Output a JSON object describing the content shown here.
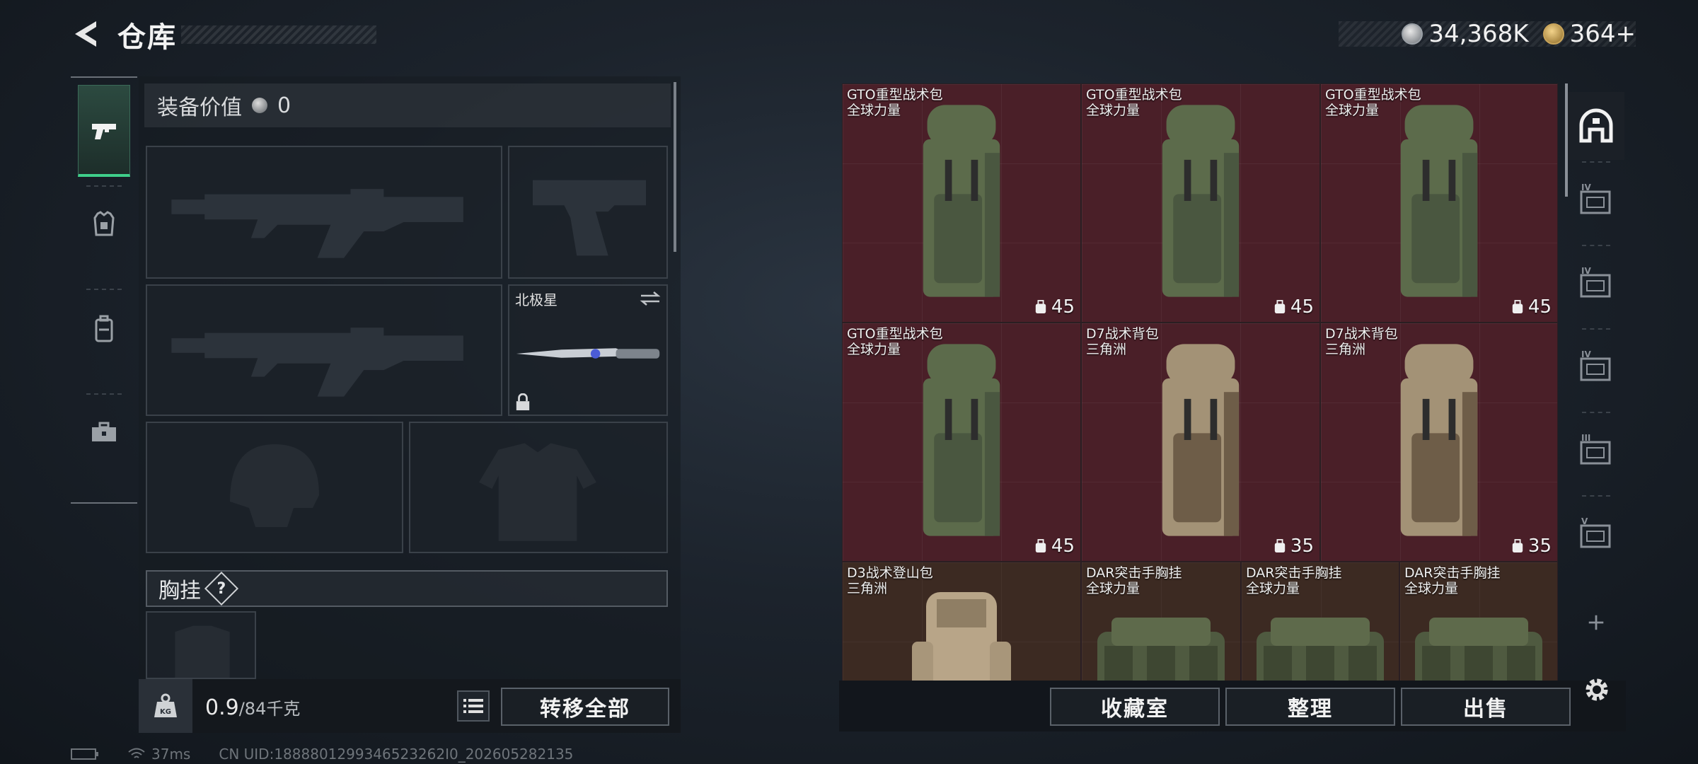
{
  "header": {
    "title": "仓库"
  },
  "currency": {
    "silver": "34,368K",
    "gold": "364+"
  },
  "equipment": {
    "value_label": "装备价值",
    "value": "0",
    "melee_slot_name": "北极星",
    "chest_label": "胸挂",
    "chest_help": "?"
  },
  "capacity": {
    "current": "0.9",
    "max": "/84千克"
  },
  "buttons": {
    "transfer_all": "转移全部",
    "collection": "收藏室",
    "organize": "整理",
    "sell": "出售"
  },
  "items": [
    {
      "name": "GTO重型战术包",
      "source": "全球力量",
      "capacity": "45",
      "color": "red",
      "art": "gto"
    },
    {
      "name": "GTO重型战术包",
      "source": "全球力量",
      "capacity": "45",
      "color": "red",
      "art": "gto"
    },
    {
      "name": "GTO重型战术包",
      "source": "全球力量",
      "capacity": "45",
      "color": "red",
      "art": "gto"
    },
    {
      "name": "GTO重型战术包",
      "source": "全球力量",
      "capacity": "45",
      "color": "red",
      "art": "gto"
    },
    {
      "name": "D7战术背包",
      "source": "三角洲",
      "capacity": "35",
      "color": "red",
      "art": "d7"
    },
    {
      "name": "D7战术背包",
      "source": "三角洲",
      "capacity": "35",
      "color": "red",
      "art": "d7"
    },
    {
      "name": "D3战术登山包",
      "source": "三角洲",
      "capacity": "",
      "color": "brown",
      "art": "d3"
    },
    {
      "name": "DAR突击手胸挂",
      "source": "全球力量",
      "capacity": "",
      "color": "brown",
      "art": "dar"
    },
    {
      "name": "DAR突击手胸挂",
      "source": "全球力量",
      "capacity": "",
      "color": "brown",
      "art": "dar"
    },
    {
      "name": "DAR突击手胸挂",
      "source": "全球力量",
      "capacity": "",
      "color": "brown",
      "art": "dar"
    }
  ],
  "side_tabs": [
    "IV",
    "IV",
    "IV",
    "III",
    "V"
  ],
  "status": {
    "ping": "37ms",
    "uid": "CN UID:1888801299346523262I0_202605282135"
  },
  "colors": {
    "accent": "#3fcf8a",
    "item_red": "#4a1f28",
    "item_brown": "#3c2a22"
  },
  "icons": [
    "back-arrow-icon",
    "silver-coin-icon",
    "gold-coin-icon",
    "pistol-icon",
    "armor-icon",
    "backpack-icon",
    "toolbox-icon",
    "lock-icon",
    "swap-icon",
    "list-icon",
    "weight-icon",
    "settings-icon",
    "plus-icon"
  ]
}
